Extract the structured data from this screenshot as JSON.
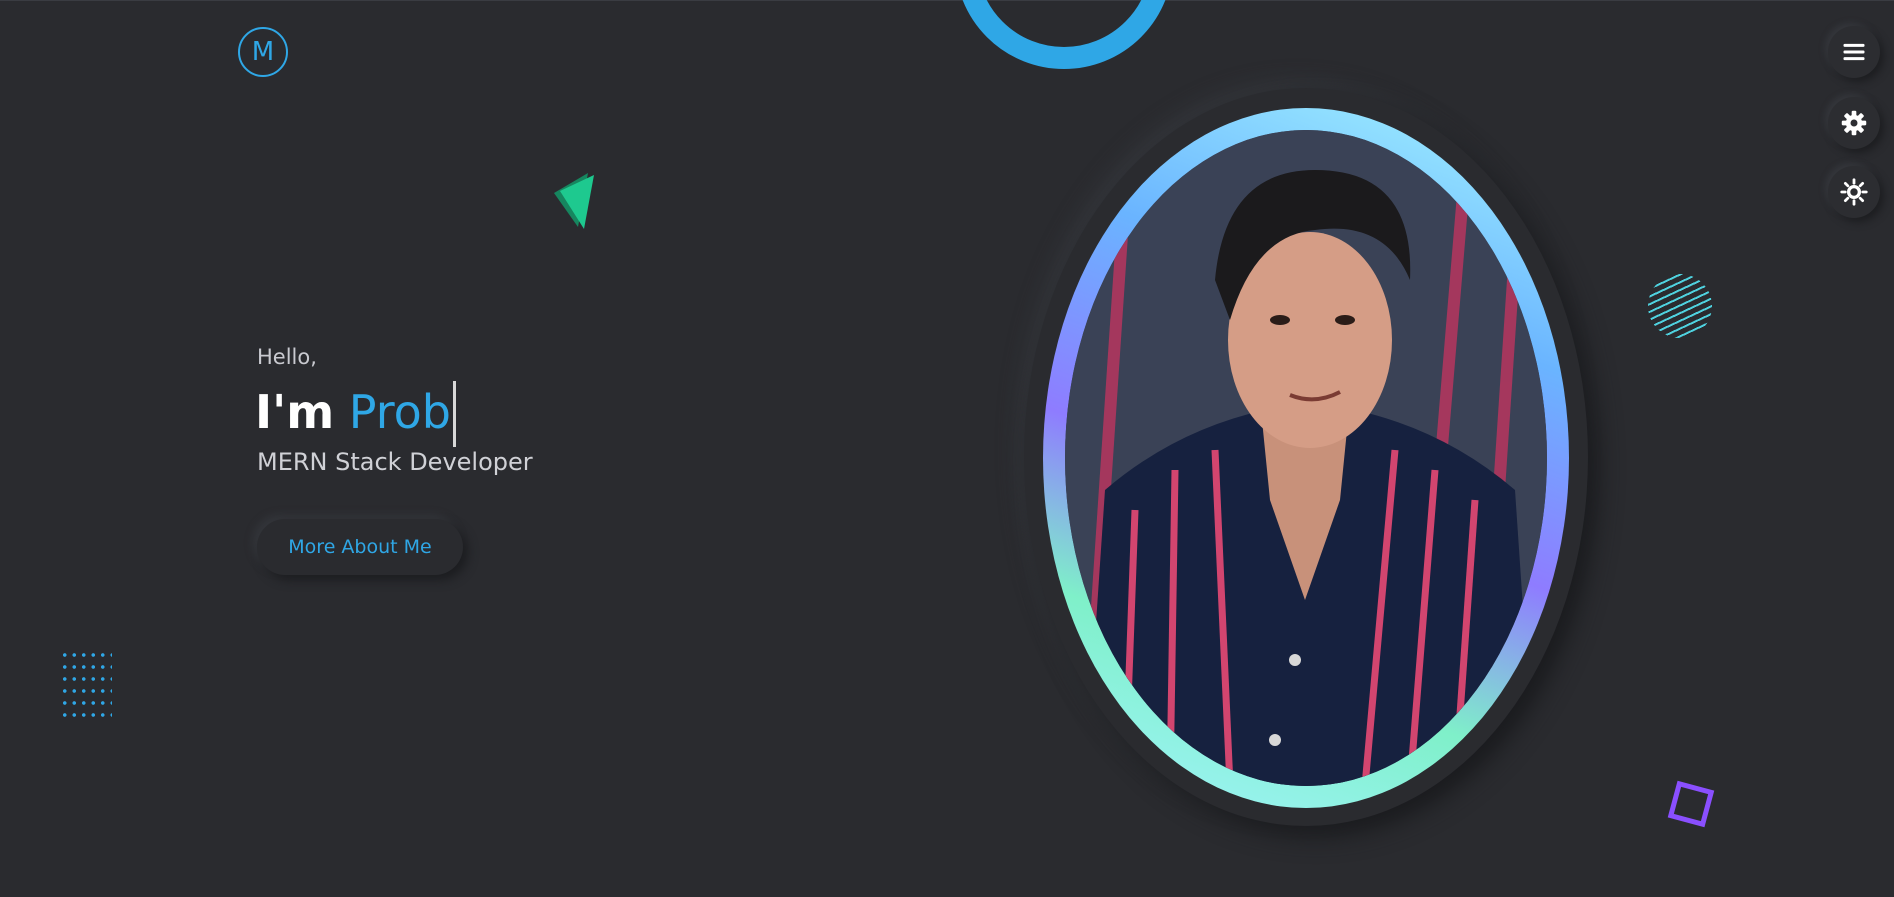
{
  "brand": {
    "logo_letter": "M"
  },
  "controls": {
    "menu_icon": "hamburger-icon",
    "settings_icon": "gear-icon",
    "theme_icon": "sun-icon"
  },
  "hero": {
    "greeting": "Hello,",
    "intro": "I'm",
    "typed_name": "Prob",
    "role": "MERN Stack Developer",
    "cta_label": "More About Me"
  },
  "colors": {
    "background": "#2a2b2f",
    "accent": "#2fa7e6",
    "triangle": "#1ec98f",
    "square": "#8a4fff",
    "stripes": "#4fd2df"
  }
}
